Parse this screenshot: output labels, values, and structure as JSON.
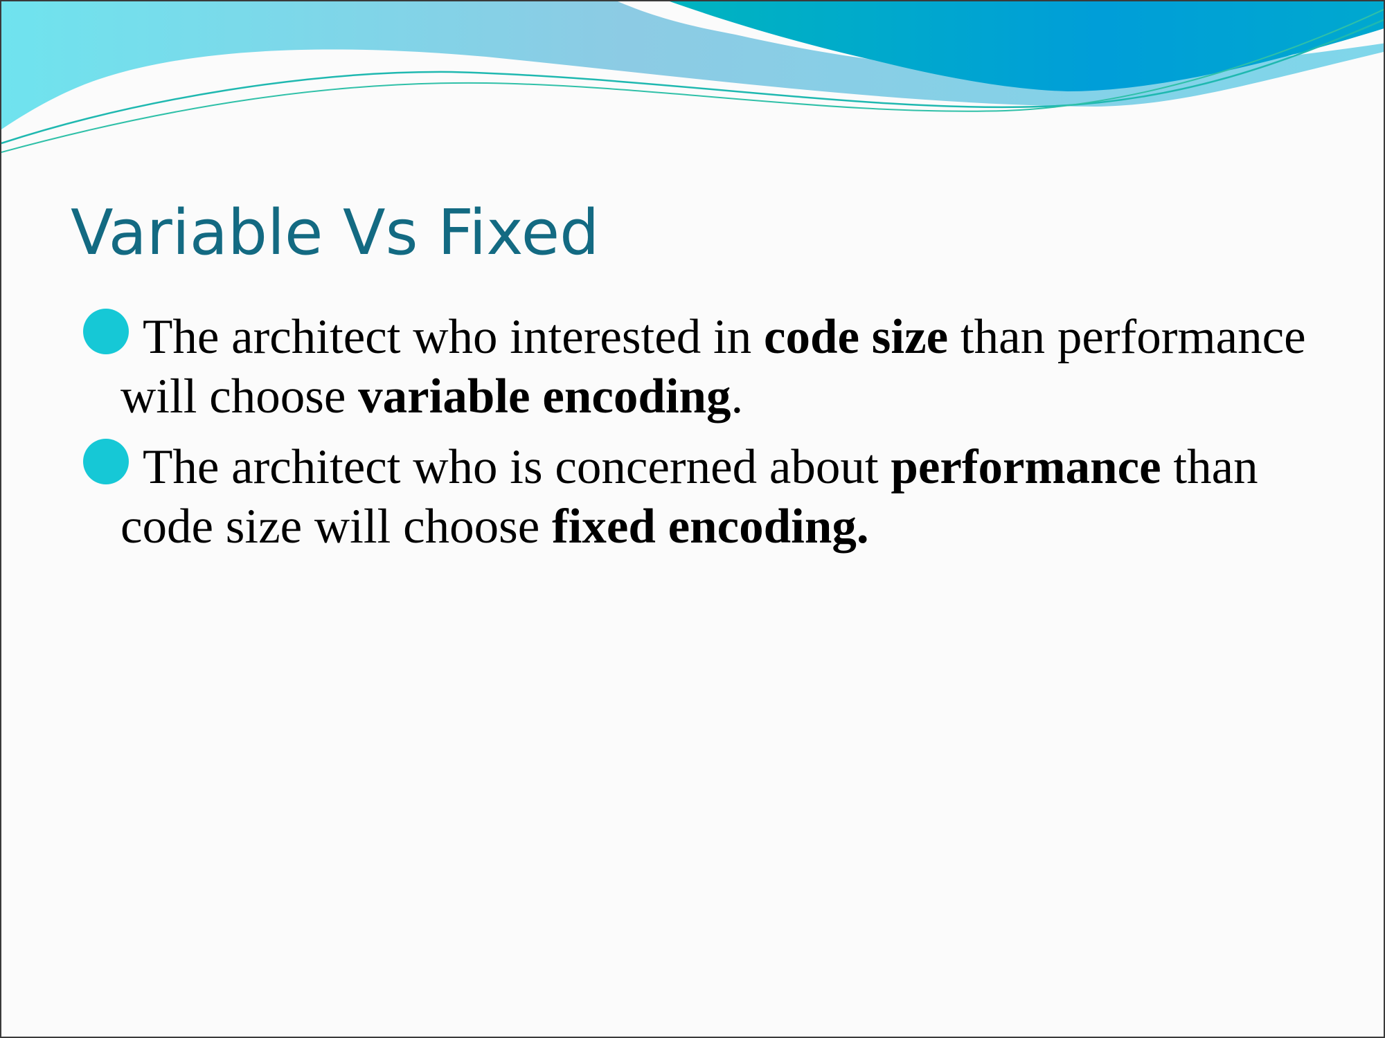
{
  "slide": {
    "title": "Variable Vs Fixed",
    "bullets": [
      {
        "parts": [
          {
            "text": "The architect who interested in ",
            "bold": false
          },
          {
            "text": "code size",
            "bold": true
          },
          {
            "text": " than performance will choose ",
            "bold": false
          },
          {
            "text": "variable encoding",
            "bold": true
          },
          {
            "text": ".",
            "bold": false
          }
        ]
      },
      {
        "parts": [
          {
            "text": "The architect who is concerned about ",
            "bold": false
          },
          {
            "text": "performance",
            "bold": true
          },
          {
            "text": " than code size will choose ",
            "bold": false
          },
          {
            "text": "fixed encoding.",
            "bold": true
          }
        ]
      }
    ]
  },
  "theme": {
    "title_color": "#136a82",
    "bullet_color": "#16c8d6",
    "wave_light": "#7fd3e6",
    "wave_dark": "#0097d6"
  }
}
